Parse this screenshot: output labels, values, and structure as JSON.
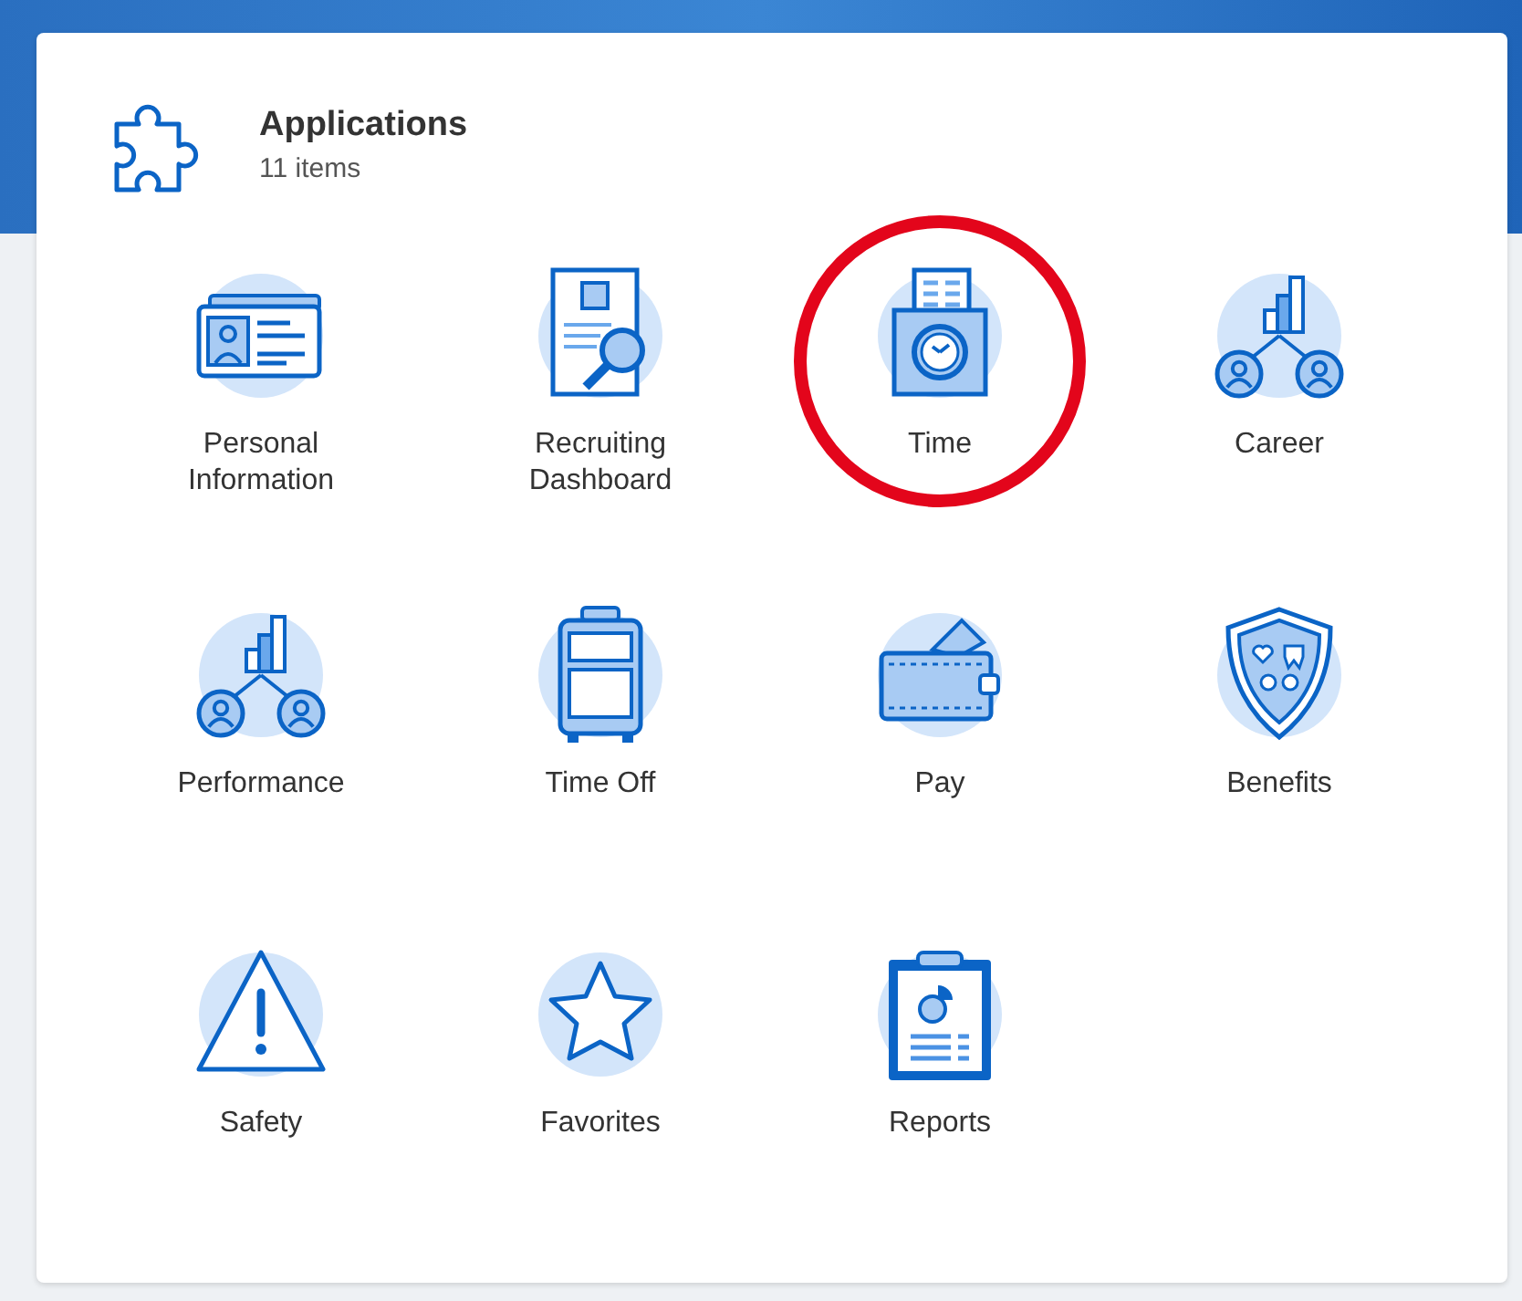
{
  "header": {
    "title": "Applications",
    "count": "11 items"
  },
  "apps": [
    {
      "label": "Personal Information",
      "kind": "id-card",
      "highlighted": false
    },
    {
      "label": "Recruiting Dashboard",
      "kind": "resume",
      "highlighted": false
    },
    {
      "label": "Time",
      "kind": "clock",
      "highlighted": true
    },
    {
      "label": "Career",
      "kind": "people-chart",
      "highlighted": false
    },
    {
      "label": "Performance",
      "kind": "people-chart",
      "highlighted": false
    },
    {
      "label": "Time Off",
      "kind": "suitcase",
      "highlighted": false
    },
    {
      "label": "Pay",
      "kind": "wallet",
      "highlighted": false
    },
    {
      "label": "Benefits",
      "kind": "shield",
      "highlighted": false
    },
    {
      "label": "Safety",
      "kind": "warning",
      "highlighted": false
    },
    {
      "label": "Favorites",
      "kind": "star",
      "highlighted": false
    },
    {
      "label": "Reports",
      "kind": "clipboard",
      "highlighted": false
    }
  ]
}
